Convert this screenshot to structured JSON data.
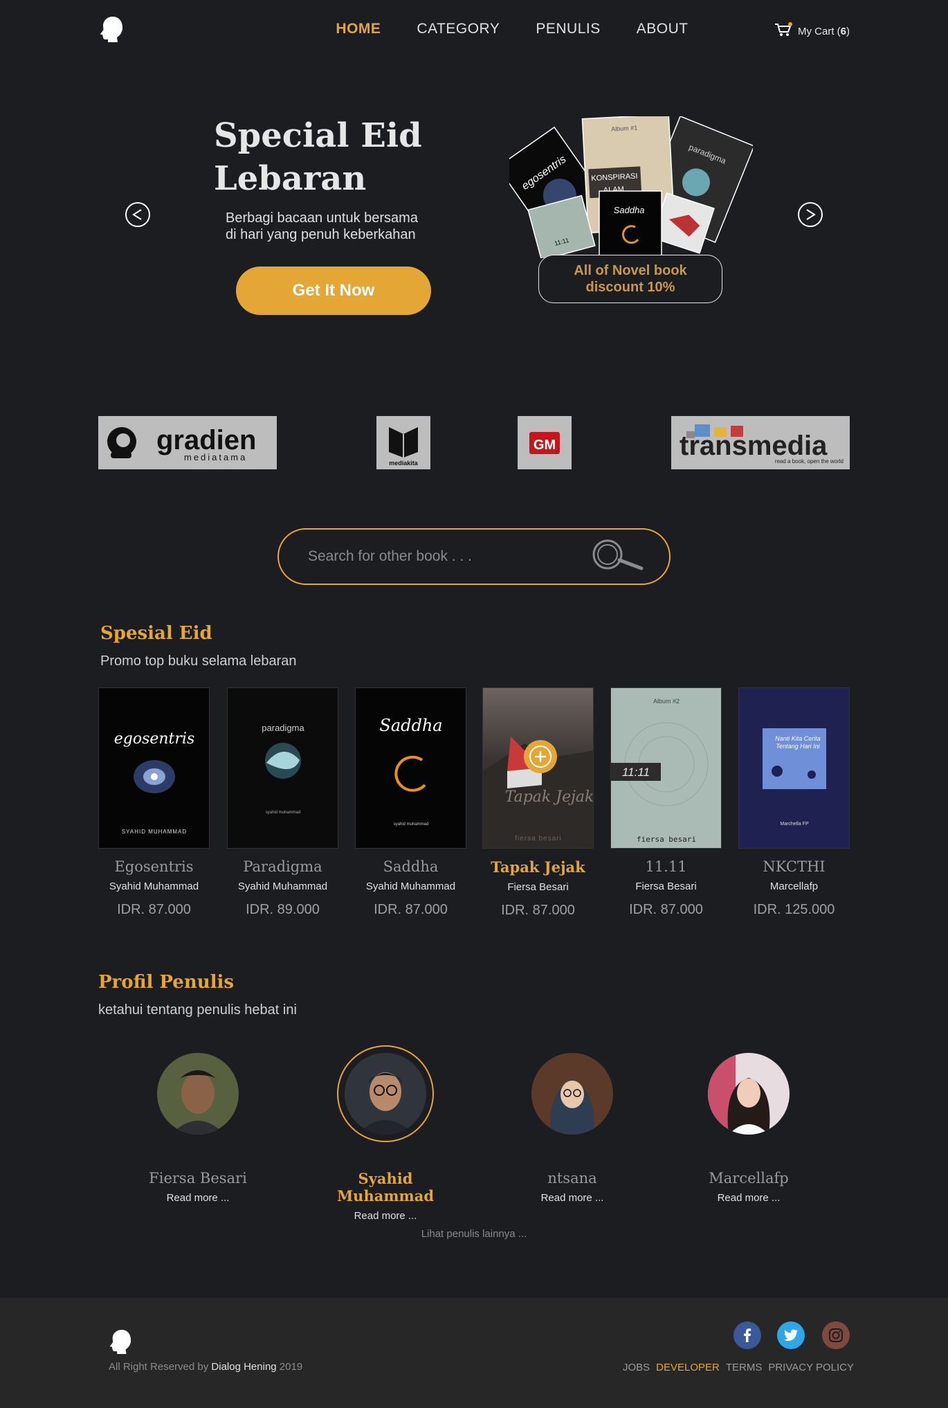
{
  "header": {
    "nav": [
      "HOME",
      "CATEGORY",
      "PENULIS",
      "ABOUT"
    ],
    "active_nav": "HOME",
    "cart_label": "My Cart (",
    "cart_count": "6",
    "cart_close": ")"
  },
  "hero": {
    "title_line1": "Special Eid",
    "title_line2": "Lebaran",
    "subtitle_line1": "Berbagi bacaan untuk bersama",
    "subtitle_line2": "di hari yang penuh keberkahan",
    "cta_label": "Get It Now",
    "discount_line1": "All of Novel book",
    "discount_line2": "discount 10%",
    "collage_texts": [
      "Album #1",
      "KONSPIRASI",
      "ALAM",
      "paradigma",
      "Saddha",
      "egosentris",
      "11:11"
    ]
  },
  "publishers": [
    {
      "name": "gradien",
      "tagline": "mediatama"
    },
    {
      "name": "mediakita"
    },
    {
      "name": "GM"
    },
    {
      "name": "transmedia",
      "tagline": "read a book, open the world"
    }
  ],
  "search": {
    "placeholder": "Search for other book . . ."
  },
  "special": {
    "title": "Spesial Eid",
    "subtitle": "Promo top buku selama lebaran",
    "books": [
      {
        "title": "Egosentris",
        "author": "Syahid Muhammad",
        "price": "IDR. 87.000",
        "cover_text": "egosentris",
        "cover_author": "SYAHID MUHAMMAD"
      },
      {
        "title": "Paradigma",
        "author": "Syahid Muhammad",
        "price": "IDR. 89.000",
        "cover_text": "paradigma",
        "cover_author": "syahid muhammad"
      },
      {
        "title": "Saddha",
        "author": "Syahid Muhammad",
        "price": "IDR. 87.000",
        "cover_text": "Saddha",
        "cover_author": "syahid muhammad"
      },
      {
        "title": "Tapak Jejak",
        "author": "Fiersa Besari",
        "price": "IDR. 87.000",
        "cover_text": "Tapak Jejak",
        "cover_author": "fiersa besari"
      },
      {
        "title": "11.11",
        "author": "Fiersa Besari",
        "price": "IDR. 87.000",
        "cover_text": "11:11",
        "cover_top": "Album #2",
        "cover_author": "fiersa besari"
      },
      {
        "title": "NKCTHI",
        "author": "Marcellafp",
        "price": "IDR. 125.000",
        "cover_text": "Nanti Kita Cerita Tentang Hari Ini",
        "cover_author": "Marchella FP"
      }
    ],
    "active_book": "Tapak Jejak"
  },
  "authors_section": {
    "title": "Profil Penulis",
    "subtitle": "ketahui tentang penulis hebat ini",
    "authors": [
      {
        "name": "Fiersa Besari",
        "read_more": "Read more ..."
      },
      {
        "name": "Syahid Muhammad",
        "read_more": "Read more ..."
      },
      {
        "name": "ntsana",
        "read_more": "Read more ..."
      },
      {
        "name": "Marcellafp",
        "read_more": "Read more ..."
      }
    ],
    "active_author": "Syahid Muhammad",
    "more_label": "Lihat penulis lainnya ..."
  },
  "footer": {
    "copyright_prefix": "All Right Reserved by ",
    "brand": "Dialog Hening",
    "year": " 2019",
    "links": [
      "JOBS",
      "DEVELOPER",
      "TERMS",
      "PRIVACY POLICY"
    ],
    "highlight_link": "DEVELOPER",
    "social": [
      "facebook",
      "twitter",
      "instagram"
    ]
  },
  "colors": {
    "accent": "#e4a634",
    "background": "#1c1d21",
    "footer": "#272728"
  },
  "icons": [
    "logo-head-icon",
    "cart-icon",
    "arrow-left-icon",
    "arrow-right-icon",
    "search-icon",
    "plus-icon",
    "facebook-icon",
    "twitter-icon",
    "instagram-icon"
  ]
}
